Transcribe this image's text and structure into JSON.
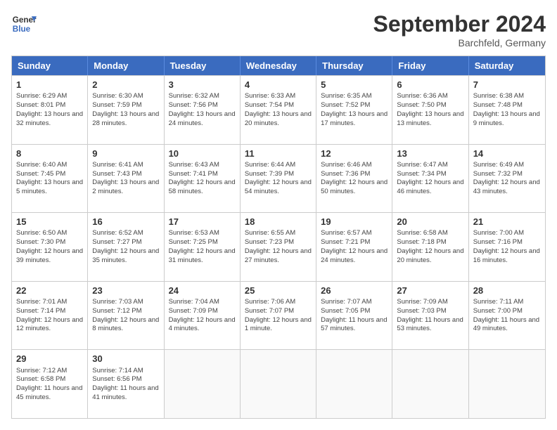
{
  "header": {
    "logo_general": "General",
    "logo_blue": "Blue",
    "month_title": "September 2024",
    "location": "Barchfeld, Germany"
  },
  "weekdays": [
    "Sunday",
    "Monday",
    "Tuesday",
    "Wednesday",
    "Thursday",
    "Friday",
    "Saturday"
  ],
  "weeks": [
    [
      {
        "day": "1",
        "info": "Sunrise: 6:29 AM\nSunset: 8:01 PM\nDaylight: 13 hours\nand 32 minutes."
      },
      {
        "day": "2",
        "info": "Sunrise: 6:30 AM\nSunset: 7:59 PM\nDaylight: 13 hours\nand 28 minutes."
      },
      {
        "day": "3",
        "info": "Sunrise: 6:32 AM\nSunset: 7:56 PM\nDaylight: 13 hours\nand 24 minutes."
      },
      {
        "day": "4",
        "info": "Sunrise: 6:33 AM\nSunset: 7:54 PM\nDaylight: 13 hours\nand 20 minutes."
      },
      {
        "day": "5",
        "info": "Sunrise: 6:35 AM\nSunset: 7:52 PM\nDaylight: 13 hours\nand 17 minutes."
      },
      {
        "day": "6",
        "info": "Sunrise: 6:36 AM\nSunset: 7:50 PM\nDaylight: 13 hours\nand 13 minutes."
      },
      {
        "day": "7",
        "info": "Sunrise: 6:38 AM\nSunset: 7:48 PM\nDaylight: 13 hours\nand 9 minutes."
      }
    ],
    [
      {
        "day": "8",
        "info": "Sunrise: 6:40 AM\nSunset: 7:45 PM\nDaylight: 13 hours\nand 5 minutes."
      },
      {
        "day": "9",
        "info": "Sunrise: 6:41 AM\nSunset: 7:43 PM\nDaylight: 13 hours\nand 2 minutes."
      },
      {
        "day": "10",
        "info": "Sunrise: 6:43 AM\nSunset: 7:41 PM\nDaylight: 12 hours\nand 58 minutes."
      },
      {
        "day": "11",
        "info": "Sunrise: 6:44 AM\nSunset: 7:39 PM\nDaylight: 12 hours\nand 54 minutes."
      },
      {
        "day": "12",
        "info": "Sunrise: 6:46 AM\nSunset: 7:36 PM\nDaylight: 12 hours\nand 50 minutes."
      },
      {
        "day": "13",
        "info": "Sunrise: 6:47 AM\nSunset: 7:34 PM\nDaylight: 12 hours\nand 46 minutes."
      },
      {
        "day": "14",
        "info": "Sunrise: 6:49 AM\nSunset: 7:32 PM\nDaylight: 12 hours\nand 43 minutes."
      }
    ],
    [
      {
        "day": "15",
        "info": "Sunrise: 6:50 AM\nSunset: 7:30 PM\nDaylight: 12 hours\nand 39 minutes."
      },
      {
        "day": "16",
        "info": "Sunrise: 6:52 AM\nSunset: 7:27 PM\nDaylight: 12 hours\nand 35 minutes."
      },
      {
        "day": "17",
        "info": "Sunrise: 6:53 AM\nSunset: 7:25 PM\nDaylight: 12 hours\nand 31 minutes."
      },
      {
        "day": "18",
        "info": "Sunrise: 6:55 AM\nSunset: 7:23 PM\nDaylight: 12 hours\nand 27 minutes."
      },
      {
        "day": "19",
        "info": "Sunrise: 6:57 AM\nSunset: 7:21 PM\nDaylight: 12 hours\nand 24 minutes."
      },
      {
        "day": "20",
        "info": "Sunrise: 6:58 AM\nSunset: 7:18 PM\nDaylight: 12 hours\nand 20 minutes."
      },
      {
        "day": "21",
        "info": "Sunrise: 7:00 AM\nSunset: 7:16 PM\nDaylight: 12 hours\nand 16 minutes."
      }
    ],
    [
      {
        "day": "22",
        "info": "Sunrise: 7:01 AM\nSunset: 7:14 PM\nDaylight: 12 hours\nand 12 minutes."
      },
      {
        "day": "23",
        "info": "Sunrise: 7:03 AM\nSunset: 7:12 PM\nDaylight: 12 hours\nand 8 minutes."
      },
      {
        "day": "24",
        "info": "Sunrise: 7:04 AM\nSunset: 7:09 PM\nDaylight: 12 hours\nand 4 minutes."
      },
      {
        "day": "25",
        "info": "Sunrise: 7:06 AM\nSunset: 7:07 PM\nDaylight: 12 hours\nand 1 minute."
      },
      {
        "day": "26",
        "info": "Sunrise: 7:07 AM\nSunset: 7:05 PM\nDaylight: 11 hours\nand 57 minutes."
      },
      {
        "day": "27",
        "info": "Sunrise: 7:09 AM\nSunset: 7:03 PM\nDaylight: 11 hours\nand 53 minutes."
      },
      {
        "day": "28",
        "info": "Sunrise: 7:11 AM\nSunset: 7:00 PM\nDaylight: 11 hours\nand 49 minutes."
      }
    ],
    [
      {
        "day": "29",
        "info": "Sunrise: 7:12 AM\nSunset: 6:58 PM\nDaylight: 11 hours\nand 45 minutes."
      },
      {
        "day": "30",
        "info": "Sunrise: 7:14 AM\nSunset: 6:56 PM\nDaylight: 11 hours\nand 41 minutes."
      },
      {
        "day": "",
        "info": ""
      },
      {
        "day": "",
        "info": ""
      },
      {
        "day": "",
        "info": ""
      },
      {
        "day": "",
        "info": ""
      },
      {
        "day": "",
        "info": ""
      }
    ]
  ]
}
